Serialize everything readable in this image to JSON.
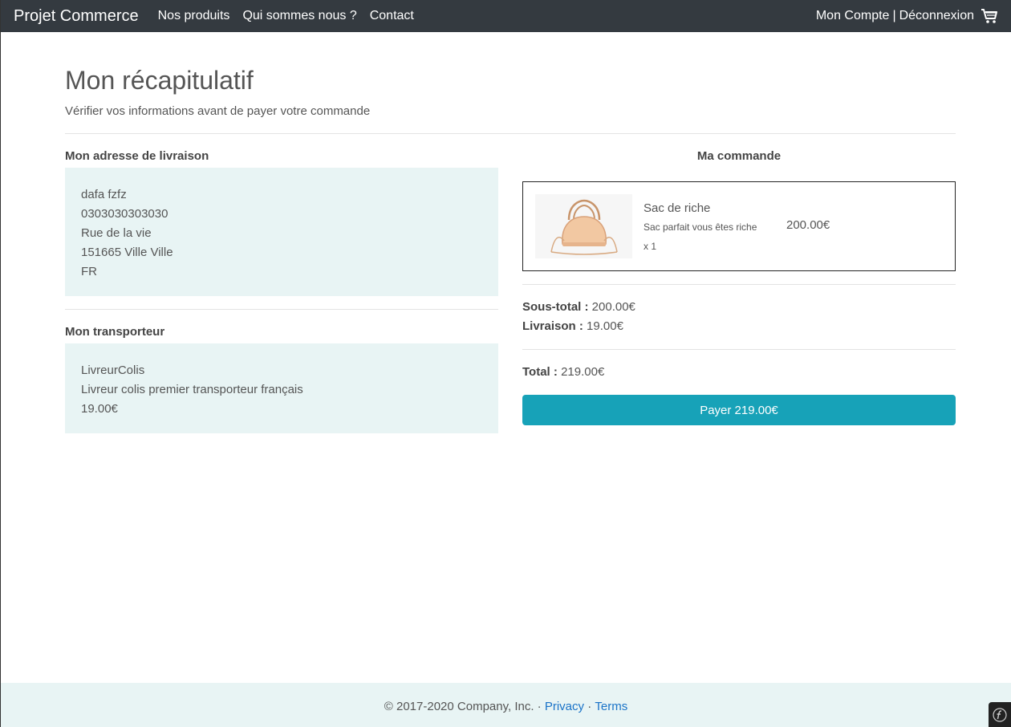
{
  "navbar": {
    "brand": "Projet Commerce",
    "links": [
      "Nos produits",
      "Qui sommes nous ?",
      "Contact"
    ],
    "account": "Mon Compte",
    "separator": "|",
    "logout": "Déconnexion",
    "cart_icon": "cart-icon"
  },
  "page": {
    "title": "Mon récapitulatif",
    "subtitle": "Vérifier vos informations avant de payer votre commande"
  },
  "address": {
    "heading": "Mon adresse de livraison",
    "lines": [
      "dafa fzfz",
      "0303030303030",
      "Rue de la vie",
      "151665 Ville Ville",
      "FR"
    ]
  },
  "carrier": {
    "heading": "Mon transporteur",
    "lines": [
      "LivreurColis",
      "Livreur colis premier transporteur français",
      "19.00€"
    ]
  },
  "order": {
    "heading": "Ma commande",
    "product": {
      "name": "Sac de riche",
      "description": "Sac parfait vous êtes riche",
      "quantity": "x 1",
      "price": "200.00€",
      "image_icon": "handbag-image"
    },
    "subtotal_label": "Sous-total :",
    "subtotal_value": "200.00€",
    "shipping_label": "Livraison :",
    "shipping_value": "19.00€",
    "total_label": "Total :",
    "total_value": "219.00€",
    "pay_button": "Payer 219.00€"
  },
  "footer": {
    "copyright": "© 2017-2020 Company, Inc. ·",
    "privacy": "Privacy",
    "dot": "·",
    "terms": "Terms"
  },
  "colors": {
    "navbar": "#343a40",
    "accent": "#17a2b8",
    "info_bg": "#e8f4f4",
    "link": "#1a73c8"
  }
}
